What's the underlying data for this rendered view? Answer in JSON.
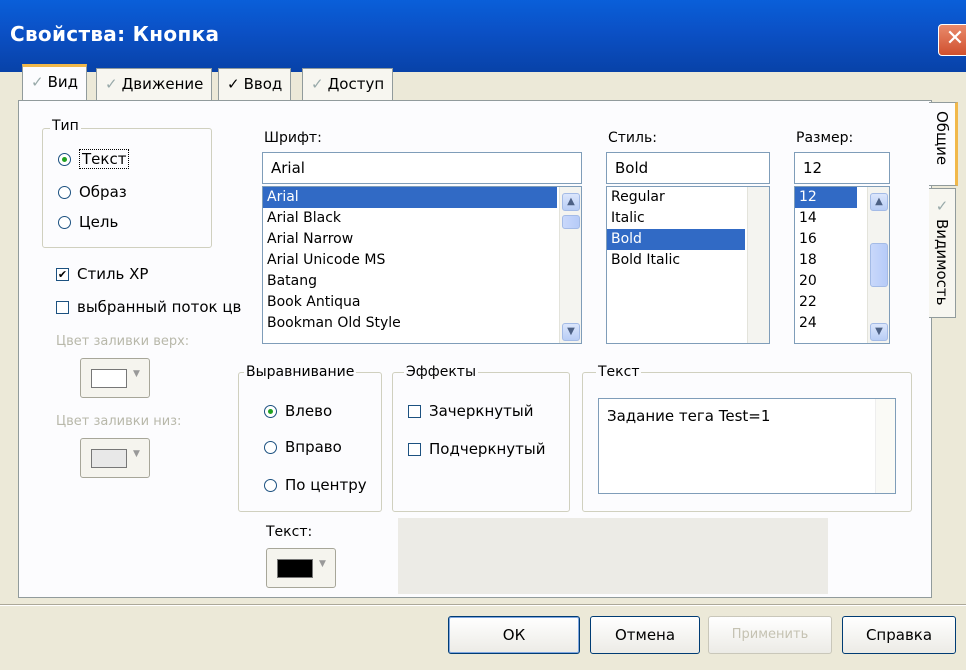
{
  "window": {
    "title": "Свойства: Кнопка",
    "close_glyph": "✕"
  },
  "tabs": [
    {
      "label": "Вид",
      "icon": "gray-check-icon"
    },
    {
      "label": "Движение",
      "icon": "gray-check-icon"
    },
    {
      "label": "Ввод",
      "icon": "check-icon"
    },
    {
      "label": "Доступ",
      "icon": "gray-check-icon"
    }
  ],
  "side_tabs": [
    {
      "label": "Общие"
    },
    {
      "label": "Видимость",
      "icon": "gray-check-icon"
    }
  ],
  "type_group": {
    "legend": "Тип",
    "options": [
      "Текст",
      "Образ",
      "Цель"
    ],
    "selected": "Текст"
  },
  "style_xp": {
    "label": "Стиль XP",
    "checked": true
  },
  "selected_stream": {
    "label": "выбранный поток цв",
    "checked": false
  },
  "fill_top_color": {
    "label": "Цвет заливки верх:"
  },
  "fill_bottom_color": {
    "label": "Цвет заливки низ:"
  },
  "font": {
    "label": "Шрифт:",
    "value": "Arial",
    "items": [
      "Arial",
      "Arial Black",
      "Arial Narrow",
      "Arial Unicode MS",
      "Batang",
      "Book Antiqua",
      "Bookman Old Style"
    ],
    "selected": "Arial"
  },
  "style": {
    "label": "Стиль:",
    "value": "Bold",
    "items": [
      "Regular",
      "Italic",
      "Bold",
      "Bold Italic"
    ],
    "selected": "Bold"
  },
  "size": {
    "label": "Размер:",
    "value": "12",
    "items": [
      "12",
      "14",
      "16",
      "18",
      "20",
      "22",
      "24"
    ],
    "selected": "12"
  },
  "align_group": {
    "legend": "Выравнивание",
    "options": [
      "Влево",
      "Вправо",
      "По центру"
    ],
    "selected": "Влево"
  },
  "effects_group": {
    "legend": "Эффекты",
    "options": [
      "Зачеркнутый",
      "Подчеркнутый"
    ]
  },
  "text_group": {
    "legend": "Текст",
    "value": "Задание тега Test=1"
  },
  "text_color": {
    "label": "Текст:",
    "color": "#000000"
  },
  "buttons": {
    "ok": "ОК",
    "cancel": "Отмена",
    "apply": "Применить",
    "help": "Справка"
  },
  "colors": {
    "titlebar": "#0b50c5",
    "selection": "#316ac5",
    "tab_highlight": "#f1b84a"
  }
}
